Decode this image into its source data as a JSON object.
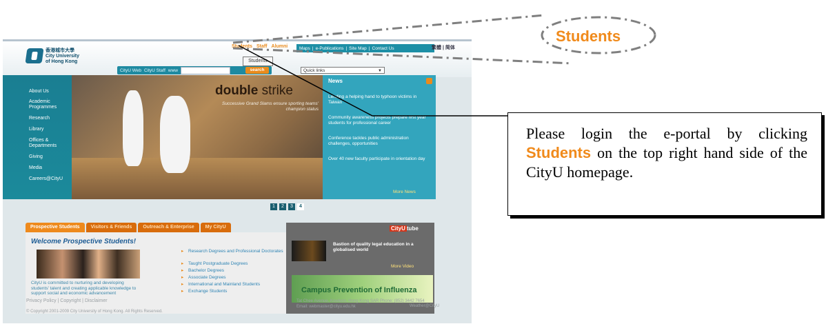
{
  "site": {
    "logo": {
      "chinese": "香港城市大學",
      "name_line1": "City University",
      "name_line2": "of Hong Kong"
    },
    "top_links": [
      "Students",
      "Staff",
      "Alumni"
    ],
    "toolbar_links": [
      "Maps",
      "|",
      "e-Publications",
      "|",
      "Site Map",
      "|",
      "Contact Us"
    ],
    "language_links": "繁體 | 简体",
    "tooltip": "Students",
    "search": {
      "option1": "CityU Web",
      "option2": "CityU Staff",
      "option3": "www",
      "button": "search",
      "quick_links": "Quick links"
    },
    "nav": [
      "About Us",
      "Academic Programmes",
      "Research",
      "Library",
      "Offices & Departments",
      "Giving",
      "Media",
      "Careers@CityU"
    ],
    "hero": {
      "title_bold": "double",
      "title_rest": "strike",
      "subtitle": "Successive Grand Slams ensure sporting teams' champion status"
    },
    "news": {
      "title": "News",
      "items": [
        "Lending a helping hand to typhoon victims in Taiwan",
        "Community awareness projects prepare first year students for professional career",
        "Conference tackles public administration challenges, opportunities",
        "Over 40 new faculty participate in orientation day"
      ],
      "more": "More News"
    },
    "pager": [
      "1",
      "2",
      "3",
      "4"
    ],
    "tabs": [
      "Prospective Students",
      "Visitors & Friends",
      "Outreach & Enterprise",
      "My CityU"
    ],
    "welcome": "Welcome Prospective Students!",
    "intro": "CityU is committed to nurturing and developing students' talent and creating applicable knowledge to support social and economic advancement",
    "degrees": [
      "Research Degrees and Professional Doctorates",
      "Taught Postgraduate Degrees",
      "Bachelor Degrees",
      "Associate Degrees",
      "International and Mainland Students",
      "Exchange Students"
    ],
    "cityutube": {
      "logo_city": "CityU",
      "logo_tube": "tube",
      "video_title": "Bastion of quality legal education in a globalised world",
      "more_video": "More Video",
      "banner": "Campus Prevention of Influenza"
    },
    "footer": {
      "links": "Privacy Policy  |  Copyright  |  Disclaimer",
      "copyright": "© Copyright 2001-2009 City University of Hong Kong. All Rights Reserved.",
      "address": "Tat Chee Avenue, Kowloon, Hong Kong SAR    Phone: (852) 3442 7654",
      "email": "Email: webmaster@cityu.edu.hk",
      "weather": "Weather@CityU"
    }
  },
  "zoom_label": "Students",
  "callout": {
    "before": "Please login the e-portal by clicking ",
    "highlight": "Students",
    "after": " on the top right hand side of the CityU homepage."
  },
  "colors": {
    "accent": "#f08a1b",
    "teal": "#1b8a9b"
  }
}
